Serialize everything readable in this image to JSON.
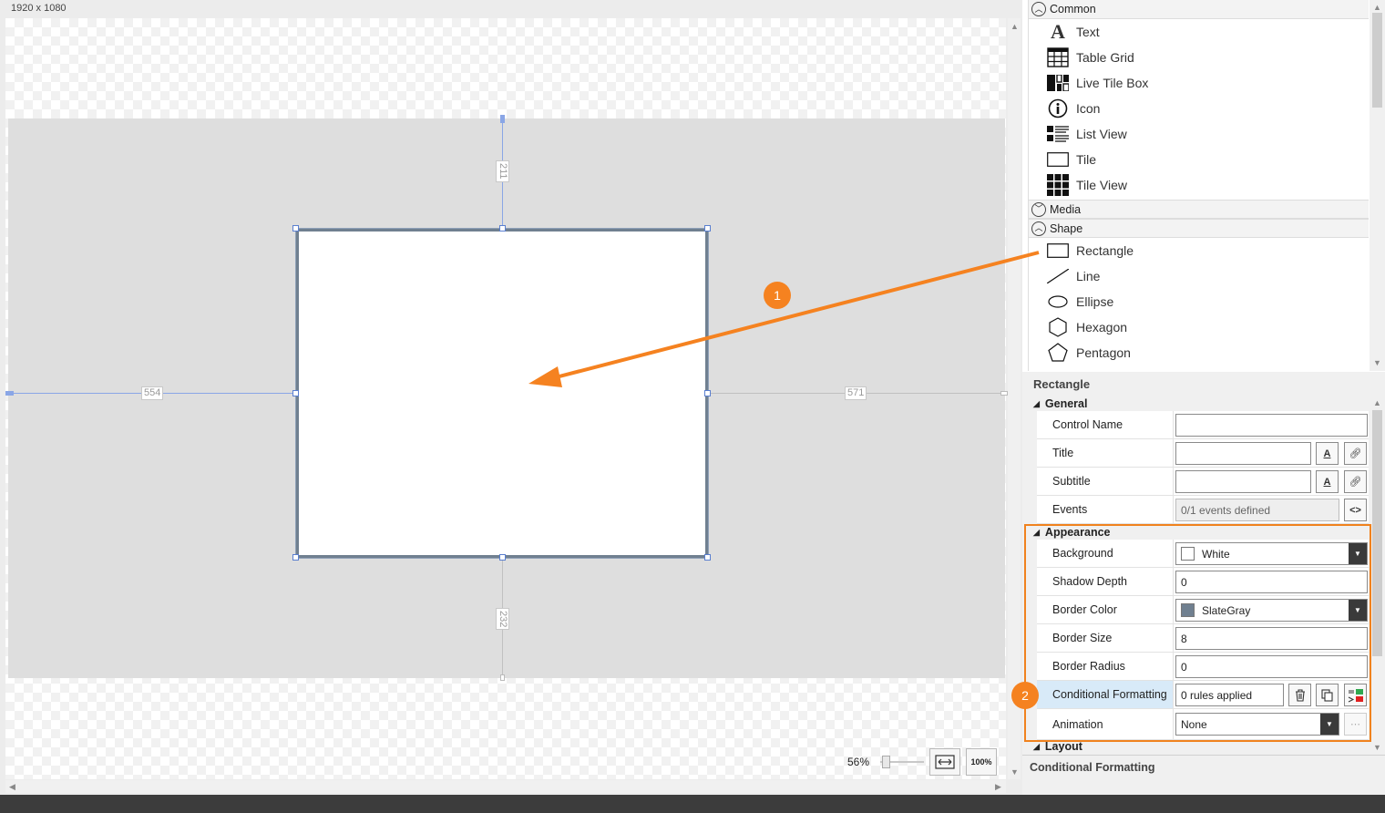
{
  "canvas": {
    "resolution_label": "1920 x 1080",
    "dim_top": "211",
    "dim_left": "554",
    "dim_right": "571",
    "dim_bottom": "232",
    "zoom_value": "56%",
    "zoom_fit_label": "⟺",
    "zoom_100_label": "100%"
  },
  "toolbox": {
    "groups": [
      {
        "label": "Common",
        "expanded": true
      },
      {
        "label": "Media",
        "expanded": false
      },
      {
        "label": "Shape",
        "expanded": true
      }
    ],
    "common_items": [
      {
        "label": "Text",
        "icon": "text-icon"
      },
      {
        "label": "Table Grid",
        "icon": "table-grid-icon"
      },
      {
        "label": "Live Tile Box",
        "icon": "live-tile-box-icon"
      },
      {
        "label": "Icon",
        "icon": "info-circle-icon"
      },
      {
        "label": "List View",
        "icon": "list-view-icon"
      },
      {
        "label": "Tile",
        "icon": "tile-icon"
      },
      {
        "label": "Tile View",
        "icon": "tile-view-icon"
      }
    ],
    "shape_items": [
      {
        "label": "Rectangle",
        "icon": "rectangle-icon"
      },
      {
        "label": "Line",
        "icon": "line-icon"
      },
      {
        "label": "Ellipse",
        "icon": "ellipse-icon"
      },
      {
        "label": "Hexagon",
        "icon": "hexagon-icon"
      },
      {
        "label": "Pentagon",
        "icon": "pentagon-icon"
      }
    ]
  },
  "properties": {
    "title": "Rectangle",
    "sections": {
      "general": "General",
      "appearance": "Appearance",
      "layout": "Layout"
    },
    "general": {
      "control_name_label": "Control Name",
      "control_name_value": "",
      "title_label": "Title",
      "title_value": "",
      "subtitle_label": "Subtitle",
      "subtitle_value": "",
      "events_label": "Events",
      "events_value": "0/1 events defined"
    },
    "appearance": {
      "background_label": "Background",
      "background_value": "White",
      "background_color": "#FFFFFF",
      "shadow_depth_label": "Shadow Depth",
      "shadow_depth_value": "0",
      "border_color_label": "Border Color",
      "border_color_value": "SlateGray",
      "border_color_hex": "#708090",
      "border_size_label": "Border Size",
      "border_size_value": "8",
      "border_radius_label": "Border Radius",
      "border_radius_value": "0",
      "conditional_formatting_label": "Conditional Formatting",
      "conditional_formatting_value": "0 rules applied",
      "animation_label": "Animation",
      "animation_value": "None"
    },
    "status_description": "Conditional Formatting"
  },
  "annotations": {
    "badge_1": "1",
    "badge_2": "2",
    "accent_color": "#F58220"
  }
}
